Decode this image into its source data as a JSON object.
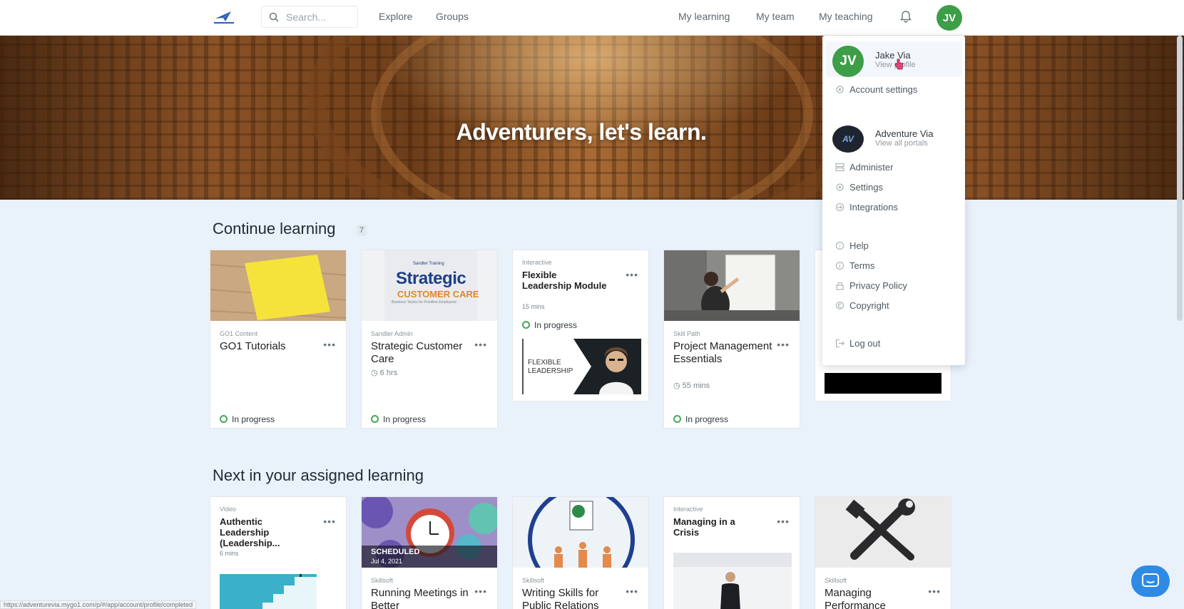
{
  "nav": {
    "search_placeholder": "Search...",
    "explore": "Explore",
    "groups": "Groups",
    "my_learning": "My learning",
    "my_team": "My team",
    "my_teaching": "My teaching",
    "avatar_initials": "JV"
  },
  "hero": {
    "heading": "Adventurers, let's learn."
  },
  "continue": {
    "title": "Continue learning",
    "count": "7",
    "cards": [
      {
        "provider": "GO1 Content",
        "title": "GO1 Tutorials",
        "duration": "",
        "status": "In progress"
      },
      {
        "provider": "Sandler Admin",
        "title": "Strategic Customer Care",
        "duration": "6 hrs",
        "status": "In progress",
        "thumb_text_top": "Strategic",
        "thumb_text_mid": "CUSTOMER CARE",
        "thumb_text_small": "Business Tactics for Frontline Employees",
        "thumb_brand": "Sandler Training"
      },
      {
        "provider": "Interactive",
        "title": "Flexible Leadership Module",
        "duration": "15 mins",
        "status": "In progress",
        "thumb_text": "FLEXIBLE LEADERSHIP"
      },
      {
        "provider": "Skill Path",
        "title": "Project Management Essentials",
        "duration": "55 mins",
        "status": "In progress"
      }
    ]
  },
  "assigned": {
    "title": "Next in your assigned learning",
    "cards": [
      {
        "provider": "Video",
        "title": "Authentic Leadership (Leadership...",
        "duration": "6 mins"
      },
      {
        "provider": "Skillsoft",
        "title": "Running Meetings in Better",
        "badge": "SCHEDULED",
        "badge_date": "Jul 4, 2021"
      },
      {
        "provider": "Skillsoft",
        "title": "Writing Skills for Public Relations"
      },
      {
        "provider": "Interactive",
        "title": "Managing in a Crisis"
      },
      {
        "provider": "Skillsoft",
        "title": "Managing Performance"
      }
    ]
  },
  "dropdown": {
    "user_initials": "JV",
    "user_name": "Jake Via",
    "user_sub": "View profile",
    "account_settings": "Account settings",
    "portal_name": "Adventure Via",
    "portal_sub": "View all portals",
    "portal_initials": "AV",
    "administer": "Administer",
    "settings": "Settings",
    "integrations": "Integrations",
    "help": "Help",
    "terms": "Terms",
    "privacy": "Privacy Policy",
    "copyright": "Copyright",
    "logout": "Log out"
  },
  "status_url": "https://adventurevia.mygo1.com/p/#/app/account/profile/completed",
  "colors": {
    "accent_green": "#3c9e47",
    "chat_blue": "#2f8ae6"
  }
}
